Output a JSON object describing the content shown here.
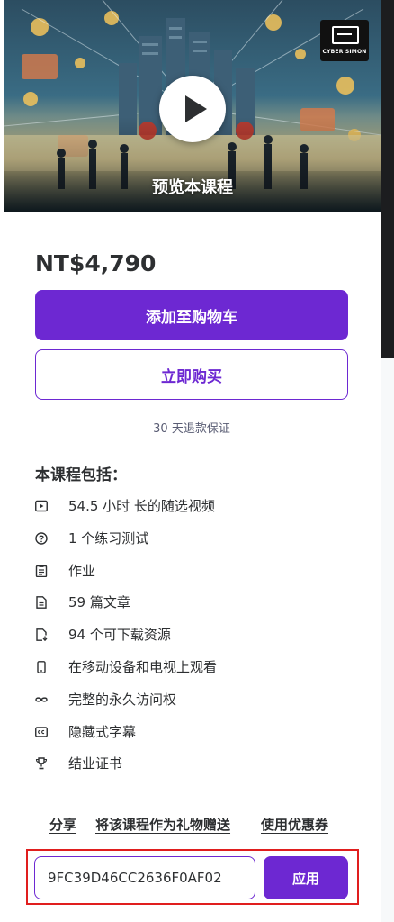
{
  "preview": {
    "label": "预览本课程",
    "logo_text": "CYBER SIMON",
    "play_icon": "play-icon"
  },
  "price": "NT$4,790",
  "buttons": {
    "add_to_cart": "添加至购物车",
    "buy_now": "立即购买"
  },
  "guarantee": "30 天退款保证",
  "includes": {
    "title": "本课程包括：",
    "items": [
      {
        "icon": "video-icon",
        "label": "54.5 小时 长的随选视频"
      },
      {
        "icon": "question-icon",
        "label": "1 个练习测试"
      },
      {
        "icon": "assignment-icon",
        "label": "作业"
      },
      {
        "icon": "article-icon",
        "label": "59 篇文章"
      },
      {
        "icon": "download-file-icon",
        "label": "94 个可下载资源"
      },
      {
        "icon": "mobile-icon",
        "label": "在移动设备和电视上观看"
      },
      {
        "icon": "infinity-icon",
        "label": "完整的永久访问权"
      },
      {
        "icon": "closed-caption-icon",
        "label": "隐藏式字幕"
      },
      {
        "icon": "trophy-icon",
        "label": "结业证书"
      }
    ]
  },
  "links": {
    "share": "分享",
    "gift": "将该课程作为礼物赠送",
    "coupon": "使用优惠券"
  },
  "coupon": {
    "value": "9FC39D46CC2636F0AF02",
    "apply": "应用"
  },
  "colors": {
    "brand": "#6d28d2",
    "highlight": "#e01e1e"
  }
}
